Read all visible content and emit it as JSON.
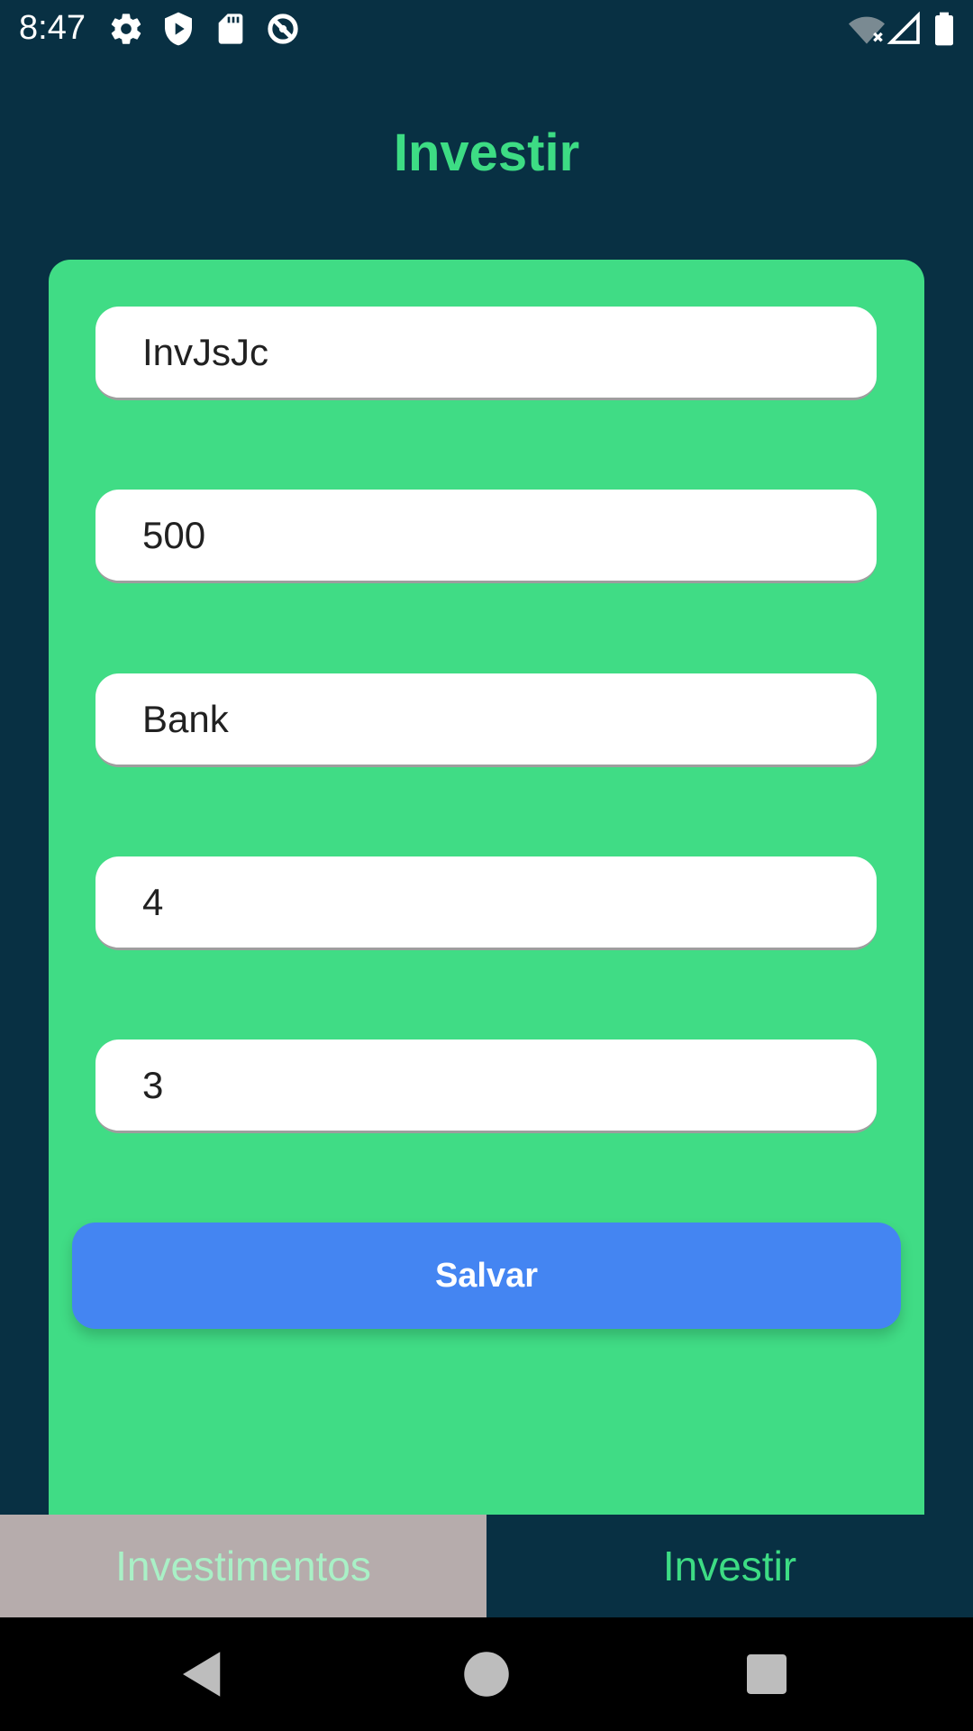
{
  "status_bar": {
    "time": "8:47",
    "icons": [
      "gear-icon",
      "shield-play-icon",
      "sd-card-icon",
      "data-saver-icon",
      "wifi-off-icon",
      "cell-signal-icon",
      "battery-icon"
    ]
  },
  "header": {
    "title": "Investir"
  },
  "form": {
    "fields": [
      {
        "value": "InvJsJc"
      },
      {
        "value": "500"
      },
      {
        "value": "Bank"
      },
      {
        "value": "4"
      },
      {
        "value": "3"
      }
    ],
    "save_label": "Salvar"
  },
  "tabs": [
    {
      "label": "Investimentos",
      "selected": false
    },
    {
      "label": "Investir",
      "selected": true
    }
  ],
  "colors": {
    "background": "#083043",
    "card": "#40dc85",
    "accent_green": "#3ddc84",
    "button": "#4485f2",
    "inactive_tab": "#b6acac"
  }
}
